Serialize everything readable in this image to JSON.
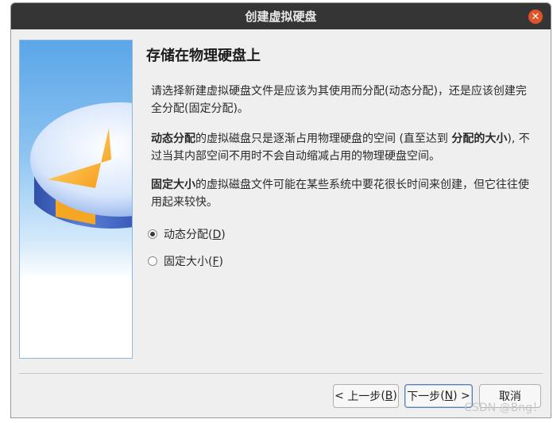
{
  "window": {
    "title": "创建虚拟硬盘"
  },
  "page": {
    "heading": "存储在物理硬盘上",
    "para1": "请选择新建虚拟硬盘文件是应该为其使用而分配(动态分配)，还是应该创建完全分配(固定分配)。",
    "para2_bold1": "动态分配",
    "para2_text1": "的虚拟磁盘只是逐渐占用物理硬盘的空间 (直至达到 ",
    "para2_bold2": "分配的大小",
    "para2_text2": "), 不过当其内部空间不用时不会自动缩减占用的物理硬盘空间。",
    "para3_bold": "固定大小",
    "para3_text": "的虚拟磁盘文件可能在某些系统中要花很长时间来创建，但它往往使用起来较快。"
  },
  "options": [
    {
      "label": "动态分配",
      "mnemonic": "D",
      "checked": true
    },
    {
      "label": "固定大小",
      "mnemonic": "F",
      "checked": false
    }
  ],
  "buttons": {
    "back": {
      "prefix": "< ",
      "label": "上一步",
      "mnemonic": "B"
    },
    "next": {
      "label": "下一步",
      "mnemonic": "N",
      "suffix": " >"
    },
    "cancel": {
      "label": "取消"
    }
  },
  "watermark": "CSDN @Bng！",
  "colors": {
    "titlebar": "#353535",
    "close": "#e25228",
    "accent_orange": "#f5a623",
    "accent_blue": "#4a86d8"
  },
  "icons": {
    "close": "close-icon",
    "side": "hard-disk-pie-illustration"
  }
}
